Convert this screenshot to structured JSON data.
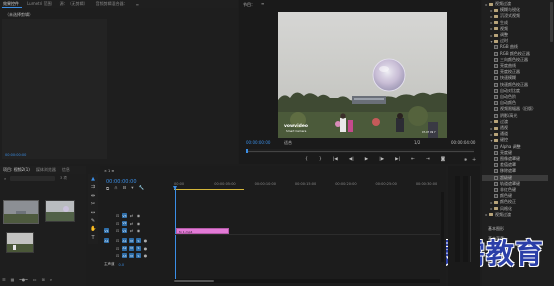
{
  "source_panel": {
    "tabs": [
      {
        "label": "效果控件",
        "active": true
      },
      {
        "label": "Lumetri 范围",
        "active": false
      },
      {
        "label": "源：（无剪辑）",
        "active": false
      },
      {
        "label": "音频剪辑混合器：",
        "active": false
      }
    ],
    "menu_icon": "menu-icon",
    "no_selection_label": "（未选择剪辑）"
  },
  "program_monitor": {
    "title": "节目：",
    "timecode_left": "00:00:00:00",
    "fit_label": "适合",
    "zoom_label": "1/2",
    "timecode_right": "00:00:04:00",
    "frame_logo_line1": "vowvideo",
    "frame_logo_line2": "Smart Camera",
    "frame_timestamp": "07-07 09 7",
    "transport_icons": [
      "mark-in-icon",
      "mark-out-icon",
      "go-to-in-icon",
      "step-back-icon",
      "play-icon",
      "step-forward-icon",
      "go-to-out-icon",
      "insert-icon",
      "overwrite-icon",
      "export-frame-icon"
    ],
    "transport_glyphs": [
      "{",
      "}",
      "|◀",
      "◀|",
      "▶",
      "|▶",
      "▶|",
      "⇤",
      "⇥",
      "◙"
    ],
    "add_button_glyph": "+"
  },
  "effects_panel": {
    "items": [
      {
        "label": "视频过渡",
        "level": 0,
        "type": "folder",
        "open": false
      },
      {
        "label": "模糊与锐化",
        "level": 1,
        "type": "folder",
        "open": false
      },
      {
        "label": "沉浸式视频",
        "level": 1,
        "type": "folder",
        "open": false
      },
      {
        "label": "生成",
        "level": 1,
        "type": "folder",
        "open": false
      },
      {
        "label": "视频",
        "level": 1,
        "type": "folder",
        "open": false
      },
      {
        "label": "调整",
        "level": 1,
        "type": "folder",
        "open": false
      },
      {
        "label": "过时",
        "level": 1,
        "type": "folder",
        "open": true
      },
      {
        "label": "RGB 曲线",
        "level": 2,
        "type": "fx"
      },
      {
        "label": "RGB 颜色校正器",
        "level": 2,
        "type": "fx"
      },
      {
        "label": "三向颜色校正器",
        "level": 2,
        "type": "fx"
      },
      {
        "label": "亮度曲线",
        "level": 2,
        "type": "fx"
      },
      {
        "label": "亮度校正器",
        "level": 2,
        "type": "fx"
      },
      {
        "label": "快速模糊",
        "level": 2,
        "type": "fx"
      },
      {
        "label": "快速颜色校正器",
        "level": 2,
        "type": "fx"
      },
      {
        "label": "自动对比度",
        "level": 2,
        "type": "fx"
      },
      {
        "label": "自动色阶",
        "level": 2,
        "type": "fx"
      },
      {
        "label": "自动颜色",
        "level": 2,
        "type": "fx"
      },
      {
        "label": "视频限幅器（旧版）",
        "level": 2,
        "type": "fx"
      },
      {
        "label": "阴影/高光",
        "level": 2,
        "type": "fx"
      },
      {
        "label": "过渡",
        "level": 1,
        "type": "folder",
        "open": false
      },
      {
        "label": "透视",
        "level": 1,
        "type": "folder",
        "open": false
      },
      {
        "label": "通道",
        "level": 1,
        "type": "folder",
        "open": false
      },
      {
        "label": "键控",
        "level": 1,
        "type": "folder",
        "open": true
      },
      {
        "label": "Alpha 调整",
        "level": 2,
        "type": "fx"
      },
      {
        "label": "亮度键",
        "level": 2,
        "type": "fx"
      },
      {
        "label": "图像遮罩键",
        "level": 2,
        "type": "fx"
      },
      {
        "label": "差值遮罩",
        "level": 2,
        "type": "fx"
      },
      {
        "label": "移除遮罩",
        "level": 2,
        "type": "fx"
      },
      {
        "label": "超级键",
        "level": 2,
        "type": "fx",
        "selected": true
      },
      {
        "label": "轨道遮罩键",
        "level": 2,
        "type": "fx"
      },
      {
        "label": "非红色键",
        "level": 2,
        "type": "fx"
      },
      {
        "label": "颜色键",
        "level": 2,
        "type": "fx"
      },
      {
        "label": "颜色校正",
        "level": 1,
        "type": "folder",
        "open": false
      },
      {
        "label": "风格化",
        "level": 1,
        "type": "folder",
        "open": false
      },
      {
        "label": "视频过渡",
        "level": 0,
        "type": "folder",
        "open": false
      }
    ],
    "bottom_labels": [
      "基本图形",
      "基本声音"
    ],
    "watermark": "最需教育"
  },
  "project_panel": {
    "tabs": [
      {
        "label": "项目: 视频2(1)",
        "active": true
      },
      {
        "label": "媒体浏览器",
        "active": false
      },
      {
        "label": "信息",
        "active": false
      }
    ],
    "search_placeholder": "",
    "items_count": "3 项",
    "thumbnails": [
      {
        "name": "thumb-1",
        "selected": true
      },
      {
        "name": "thumb-2",
        "selected": false
      },
      {
        "name": "thumb-3",
        "selected": false
      }
    ]
  },
  "timeline": {
    "title": "×  1  ≡",
    "timecode": "00:00:00:00",
    "ruler_labels": [
      "00:00",
      "00:00:05:00",
      "00:00:10:00",
      "00:00:15:00",
      "00:00:20:00",
      "00:00:25:00",
      "00:00:30:00"
    ],
    "tracks": [
      {
        "id": "V3",
        "type": "video"
      },
      {
        "id": "V2",
        "type": "video"
      },
      {
        "id": "V1",
        "type": "video"
      },
      {
        "id": "A1",
        "type": "audio"
      },
      {
        "id": "A2",
        "type": "audio"
      },
      {
        "id": "A3",
        "type": "audio"
      }
    ],
    "master_label": "主声道",
    "master_value": "0.0",
    "clip_label": "fx 1.mp4",
    "clip_color": "#e27ad6",
    "track_lock_glyph": "⊡",
    "track_eye_glyph": "◉",
    "track_sync_glyph": "⇄",
    "track_mute_glyph": "M",
    "track_solo_glyph": "S",
    "track_mic_glyph": "●"
  },
  "tools": {
    "icons": [
      "selection-tool-icon",
      "track-select-icon",
      "ripple-edit-icon",
      "razor-icon",
      "slip-icon",
      "pen-icon",
      "hand-icon",
      "text-icon"
    ],
    "glyphs": [
      "▲",
      "⇉",
      "⇹",
      "✂",
      "↔",
      "✎",
      "✋",
      "T"
    ]
  },
  "colors": {
    "accent": "#3a8ee6",
    "playhead": "#3a8ee6",
    "clip": "#e27ad6",
    "work_area": "#d4b63a"
  }
}
